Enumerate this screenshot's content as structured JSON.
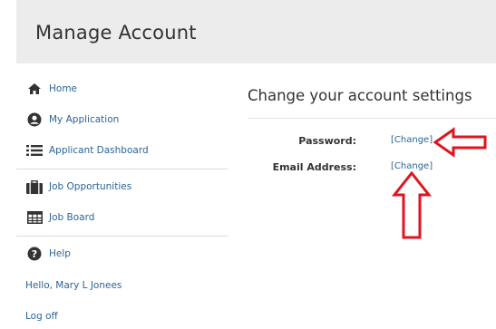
{
  "header": {
    "title": "Manage Account"
  },
  "sidebar": {
    "items": [
      {
        "label": "Home",
        "icon": "home-icon"
      },
      {
        "label": "My Application",
        "icon": "user-circle-icon"
      },
      {
        "label": "Applicant Dashboard",
        "icon": "list-icon"
      },
      {
        "label": "Job Opportunities",
        "icon": "briefcase-icon"
      },
      {
        "label": "Job Board",
        "icon": "table-icon"
      },
      {
        "label": "Help",
        "icon": "help-circle-icon"
      }
    ],
    "greeting": "Hello, Mary L Jonees",
    "logoff": "Log off"
  },
  "main": {
    "title": "Change your account settings",
    "fields": [
      {
        "label": "Password:",
        "action": "[Change]"
      },
      {
        "label": "Email Address:",
        "action": "[Change]"
      }
    ]
  },
  "colors": {
    "link": "#2a6496",
    "annotation_arrow": "#e0141e",
    "header_bg": "#ececec"
  }
}
